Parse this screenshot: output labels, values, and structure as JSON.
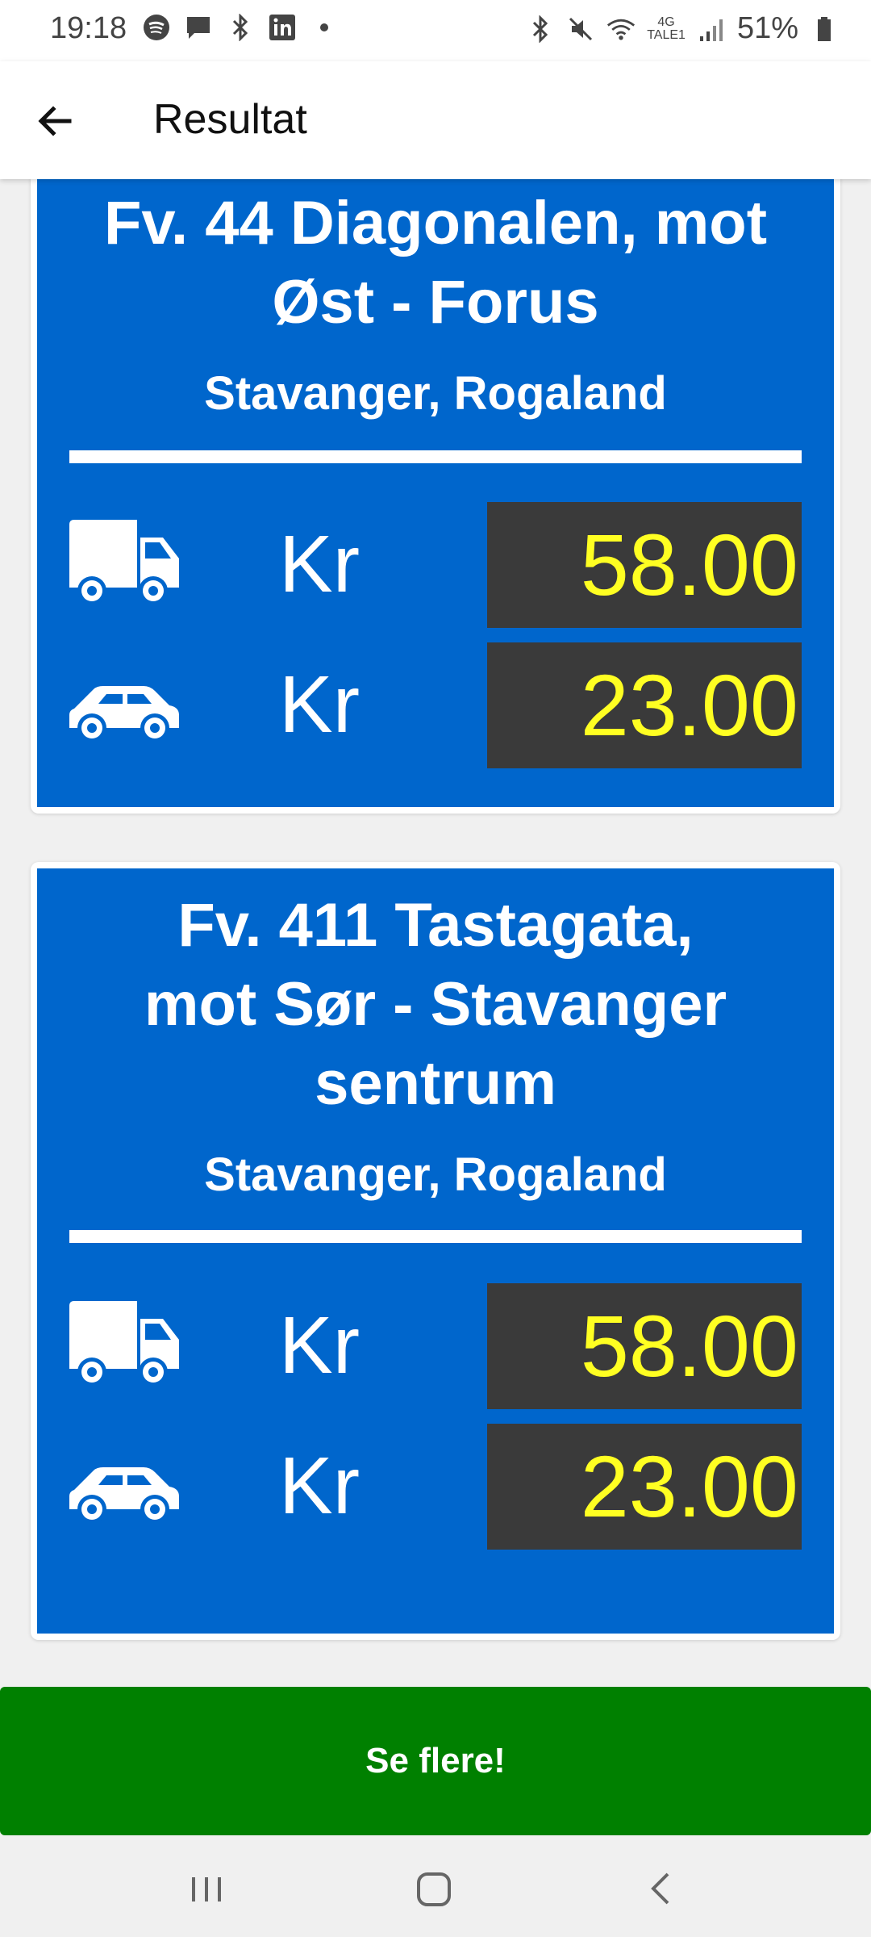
{
  "status_bar": {
    "time": "19:18",
    "network": "4G",
    "carrier": "TALE1",
    "battery": "51%",
    "left_icons": [
      "spotify-icon",
      "message-icon",
      "bluetooth-icon",
      "linkedin-icon",
      "dot-icon"
    ],
    "right_icons": [
      "bluetooth-icon",
      "mute-icon",
      "wifi-icon",
      "signal-icon",
      "battery-icon"
    ]
  },
  "app_bar": {
    "title": "Resultat",
    "back_icon": "arrow-left-icon"
  },
  "cards": [
    {
      "title_line1": "Fv. 44 Diagonalen, mot",
      "title_line2": "Øst - Forus",
      "location": "Stavanger, Rogaland",
      "rows": [
        {
          "vehicle": "truck-icon",
          "currency": "Kr",
          "price": "58.00"
        },
        {
          "vehicle": "car-icon",
          "currency": "Kr",
          "price": "23.00"
        }
      ]
    },
    {
      "title_line1": "Fv. 411 Tastagata,",
      "title_line2": "mot Sør - Stavanger",
      "title_line3": "sentrum",
      "location": "Stavanger, Rogaland",
      "rows": [
        {
          "vehicle": "truck-icon",
          "currency": "Kr",
          "price": "58.00"
        },
        {
          "vehicle": "car-icon",
          "currency": "Kr",
          "price": "23.00"
        }
      ]
    }
  ],
  "button": {
    "label": "Se flere!"
  },
  "nav_bar": {
    "items": [
      "recent-apps-icon",
      "home-icon",
      "back-icon"
    ]
  },
  "colors": {
    "card_blue": "#0066cc",
    "price_bg": "#3a3a3a",
    "price_text": "#ffff22",
    "button_green": "#008000"
  }
}
